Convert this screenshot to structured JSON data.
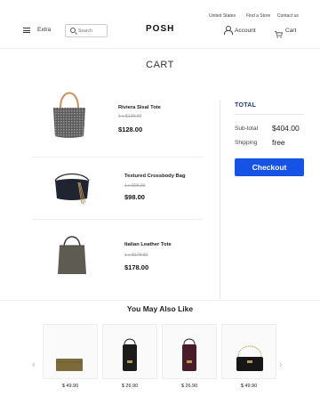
{
  "header": {
    "util_links": [
      "United States",
      "Find a Store",
      "Contact us"
    ],
    "extra_label": "Extra",
    "search_placeholder": "Search",
    "logo": "POSH",
    "account_label": "Account",
    "cart_label": "Cart"
  },
  "page_title": "CART",
  "cart_items": [
    {
      "name": "Riviera Sisal Tote",
      "qty": "1 x $128.00",
      "price": "$128.00"
    },
    {
      "name": "Textured Crossbody Bag",
      "qty": "1 x $98.00",
      "price": "$98.00"
    },
    {
      "name": "Italian Leather Tote",
      "qty": "1 x $178.00",
      "price": "$178.00"
    }
  ],
  "summary": {
    "title": "TOTAL",
    "subtotal_label": "Sub-total",
    "subtotal_value": "$404.00",
    "shipping_label": "Shipping",
    "shipping_value": "free",
    "checkout_label": "Checkout"
  },
  "recommendations": {
    "title": "You May Also Like",
    "prev_icon": "chevron-left-icon",
    "next_icon": "chevron-right-icon",
    "products": [
      {
        "price": "$ 49.90"
      },
      {
        "price": "$ 26.90"
      },
      {
        "price": "$ 26.90"
      },
      {
        "price": "$ 49.90"
      }
    ]
  },
  "colors": {
    "accent": "#1552e6",
    "total_title": "#1f3a8a"
  }
}
